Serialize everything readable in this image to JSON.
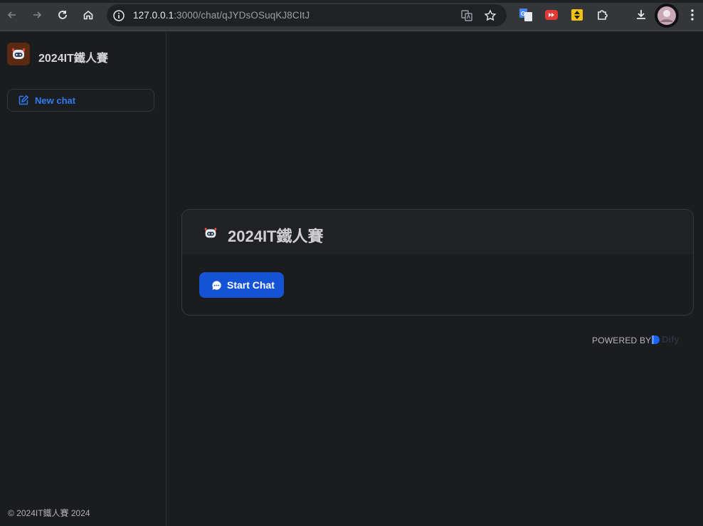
{
  "browser": {
    "url_host": "127.0.0.1",
    "url_rest": ":3000/chat/qJYDsOSuqKJ8CItJ"
  },
  "sidebar": {
    "app_name": "2024IT鐵人賽",
    "new_chat_label": "New chat",
    "footer": "© 2024IT鐵人賽 2024"
  },
  "main": {
    "card_title": "2024IT鐵人賽",
    "start_chat_label": "Start Chat",
    "powered_by": "POWERED BY",
    "brand": "Dify"
  },
  "colors": {
    "accent": "#1553d6",
    "link": "#2f7cf6",
    "background": "#1b1c1e"
  }
}
